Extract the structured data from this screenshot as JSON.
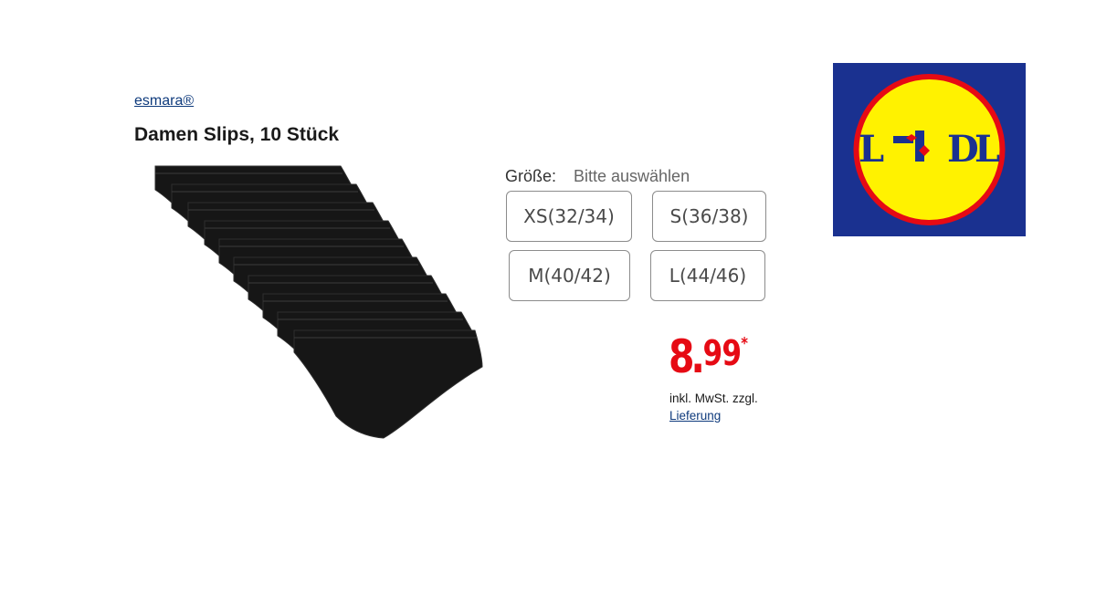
{
  "product": {
    "brand": "esmara®",
    "title": "Damen Slips, 10 Stück"
  },
  "size_selector": {
    "label": "Größe:",
    "placeholder": "Bitte auswählen",
    "options": [
      "XS(32/34)",
      "S(36/38)",
      "M(40/42)",
      "L(44/46)"
    ]
  },
  "price": {
    "euros": "8",
    "separator": ".",
    "cents": "99",
    "asterisk": "*",
    "tax_note": "inkl. MwSt. zzgl.",
    "delivery_link": "Lieferung"
  },
  "logo": {
    "text": "LIDL",
    "colors": {
      "background": "#1a3190",
      "circle": "#fff200",
      "ring": "#e60a14",
      "letters": "#1a3190",
      "dot": "#e60a14"
    }
  },
  "colors": {
    "price_red": "#e60a14",
    "link_blue": "#0e3a7c",
    "button_border": "#8c8c8c"
  },
  "icons": {
    "product_image": "black-briefs-stack"
  }
}
